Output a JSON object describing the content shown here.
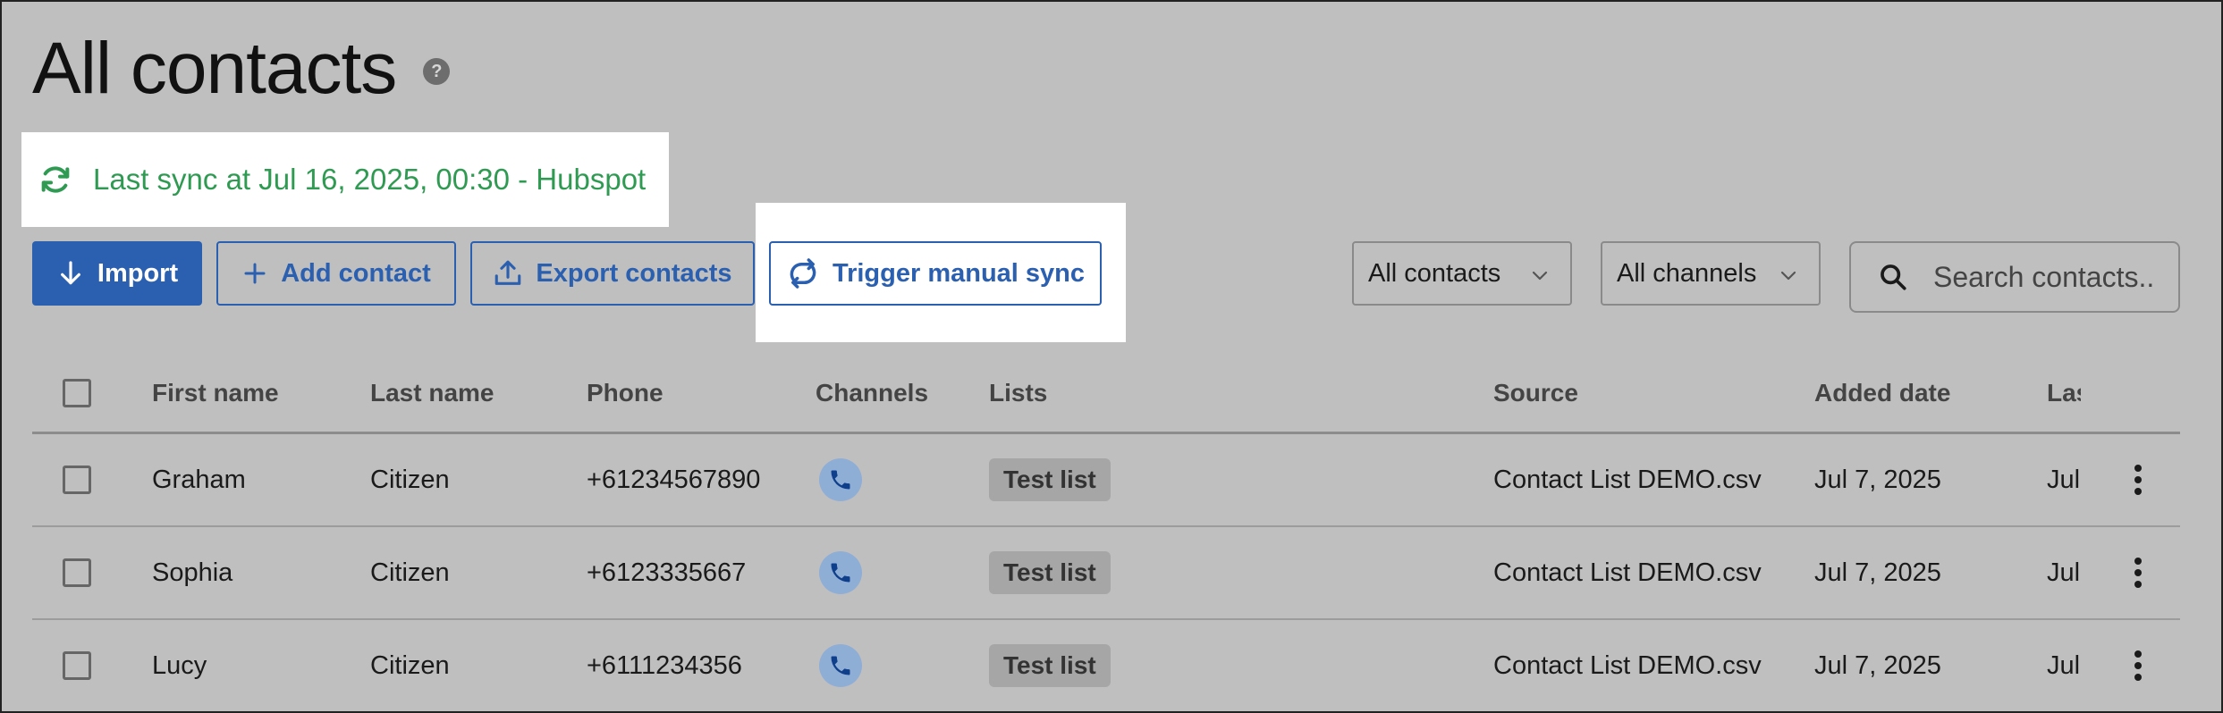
{
  "page": {
    "title": "All contacts"
  },
  "sync_status": {
    "text": "Last sync at Jul 16, 2025, 00:30 - Hubspot",
    "color": "#2f9a52"
  },
  "toolbar": {
    "import_label": "Import",
    "add_contact_label": "Add contact",
    "export_label": "Export contacts",
    "manual_sync_label": "Trigger manual sync"
  },
  "filters": {
    "contacts_select": "All contacts",
    "channels_select": "All channels",
    "search_placeholder": "Search contacts.."
  },
  "table": {
    "columns": {
      "first_name": "First name",
      "last_name": "Last name",
      "phone": "Phone",
      "channels": "Channels",
      "lists": "Lists",
      "source": "Source",
      "added_date": "Added date",
      "last": "Las"
    },
    "rows": [
      {
        "first_name": "Graham",
        "last_name": "Citizen",
        "phone": "+61234567890",
        "channel_icon": "phone-icon",
        "list": "Test list",
        "source": "Contact List DEMO.csv",
        "added_date": "Jul 7, 2025",
        "last": "Jul"
      },
      {
        "first_name": "Sophia",
        "last_name": "Citizen",
        "phone": "+6123335667",
        "channel_icon": "phone-icon",
        "list": "Test list",
        "source": "Contact List DEMO.csv",
        "added_date": "Jul 7, 2025",
        "last": "Jul"
      },
      {
        "first_name": "Lucy",
        "last_name": "Citizen",
        "phone": "+6111234356",
        "channel_icon": "phone-icon",
        "list": "Test list",
        "source": "Contact List DEMO.csv",
        "added_date": "Jul 7, 2025",
        "last": "Jul"
      }
    ]
  },
  "colors": {
    "accent": "#2b5fb0",
    "background": "#bfbfbf"
  }
}
